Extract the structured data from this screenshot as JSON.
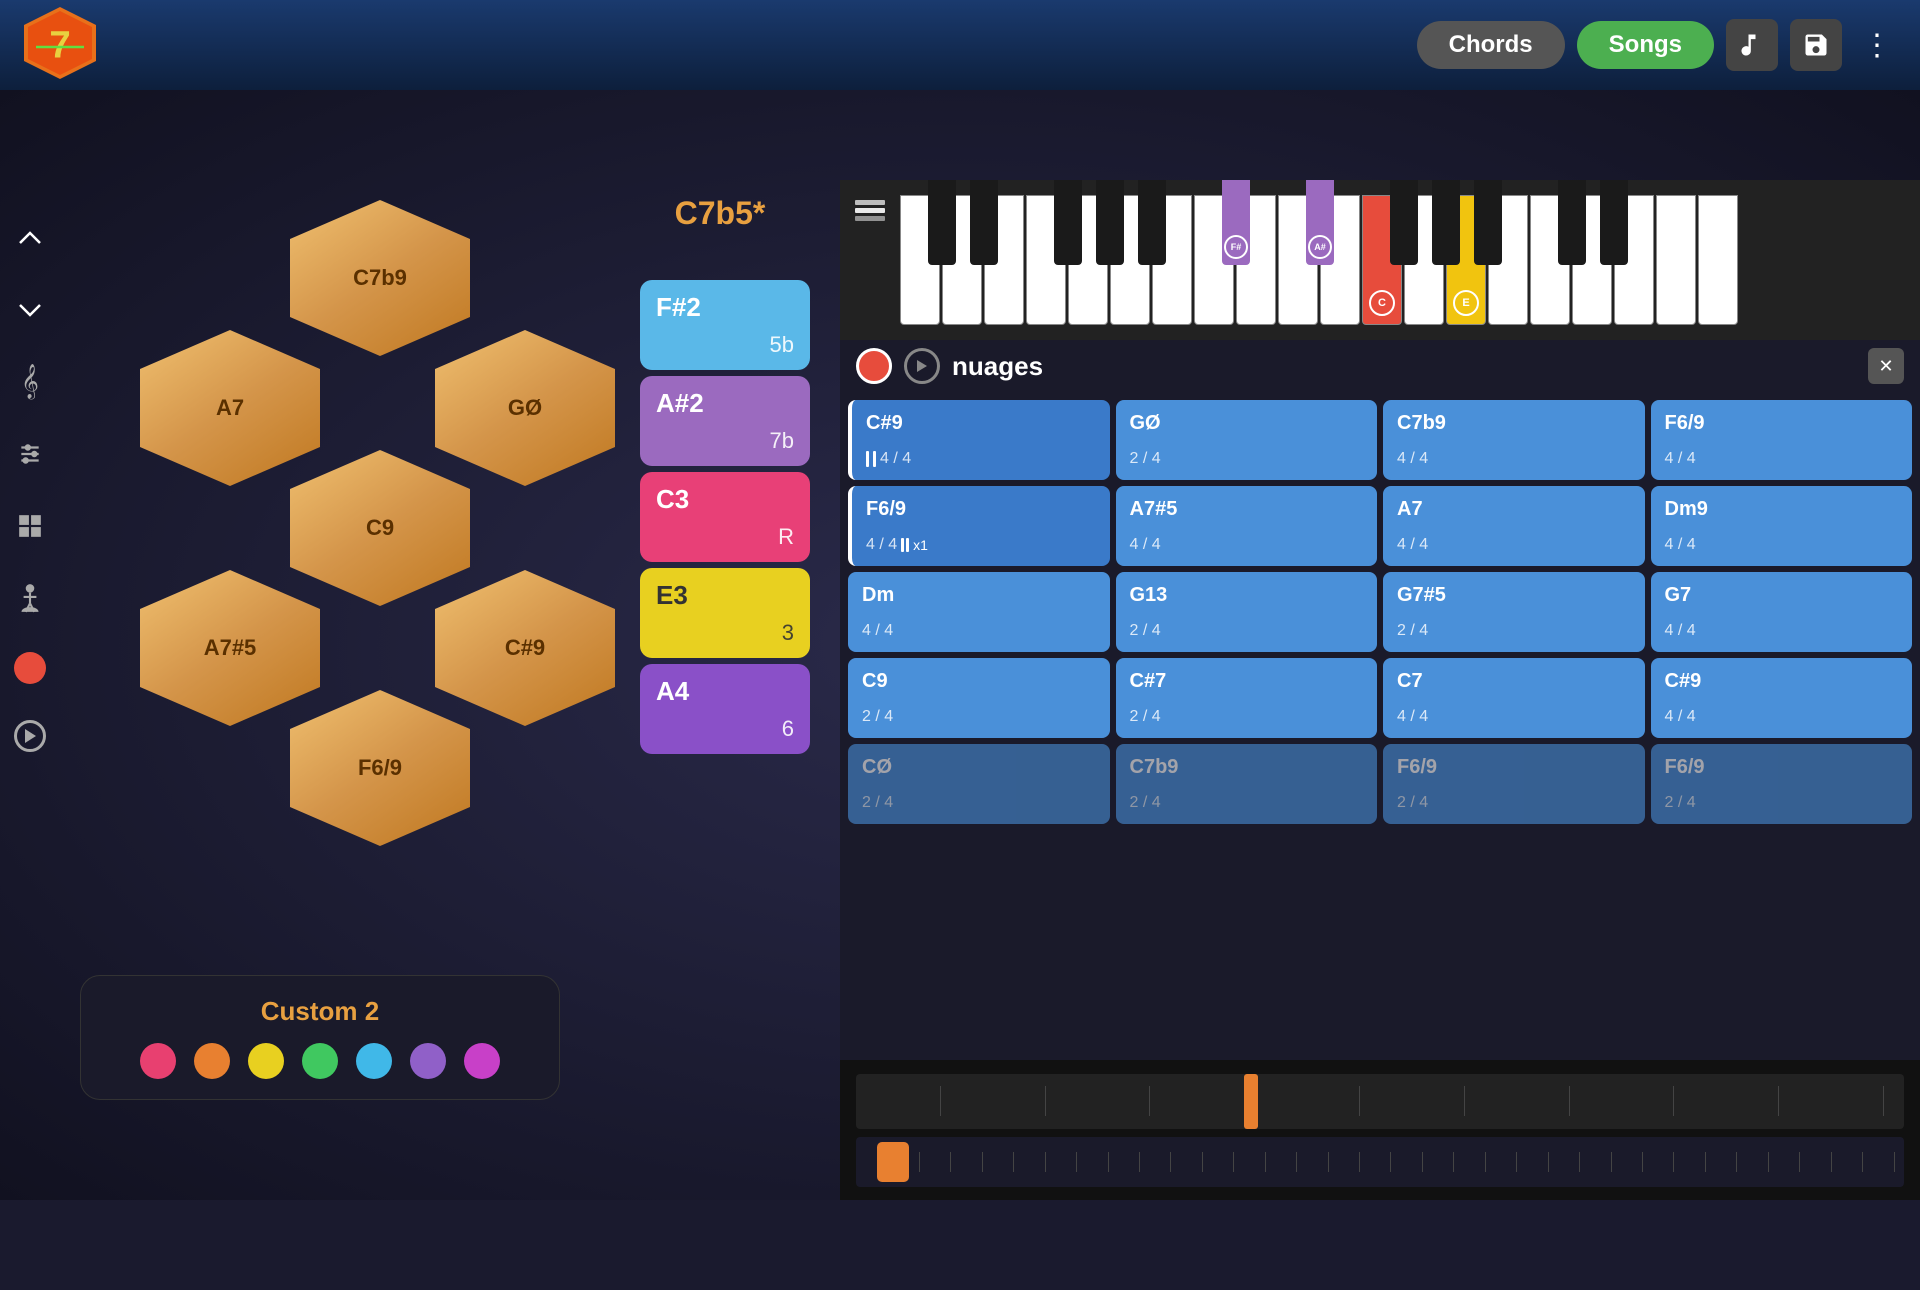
{
  "header": {
    "btn_chords": "Chords",
    "btn_songs": "Songs",
    "btn_music_note": "♪",
    "btn_save": "💾",
    "btn_more": "⋮"
  },
  "sidebar": {
    "icons": [
      {
        "name": "chevron-up",
        "glyph": "⌃"
      },
      {
        "name": "chevron-down",
        "glyph": "⌄"
      },
      {
        "name": "treble-clef",
        "glyph": "𝄞"
      },
      {
        "name": "mixer",
        "glyph": "⚙"
      },
      {
        "name": "grid",
        "glyph": "▦"
      },
      {
        "name": "person",
        "glyph": "🚶"
      },
      {
        "name": "record",
        "glyph": ""
      },
      {
        "name": "play",
        "glyph": "▶"
      }
    ]
  },
  "hex_grid": {
    "chords": [
      {
        "label": "C7b9",
        "row": 0,
        "col": 0
      },
      {
        "label": "A7",
        "row": 1,
        "col": -1
      },
      {
        "label": "GØ",
        "row": 1,
        "col": 1
      },
      {
        "label": "C9",
        "row": 2,
        "col": 0
      },
      {
        "label": "A7#5",
        "row": 3,
        "col": -1
      },
      {
        "label": "C#9",
        "row": 3,
        "col": 1
      },
      {
        "label": "F6/9",
        "row": 4,
        "col": 0
      }
    ]
  },
  "chord_display": {
    "title": "C7b5*",
    "cards": [
      {
        "name": "F#2",
        "num": "5b",
        "color": "blue"
      },
      {
        "name": "A#2",
        "num": "7b",
        "color": "purple"
      },
      {
        "name": "C3",
        "num": "R",
        "color": "pink"
      },
      {
        "name": "E3",
        "num": "3",
        "color": "yellow"
      },
      {
        "name": "A4",
        "num": "6",
        "color": "purple2"
      }
    ]
  },
  "custom_panel": {
    "title": "Custom 2",
    "colors": [
      "#e84070",
      "#e88030",
      "#e8d020",
      "#40c860",
      "#40b8e8",
      "#9060c8",
      "#c840c8"
    ]
  },
  "piano": {
    "active_notes": [
      "F#",
      "A#",
      "C",
      "E"
    ],
    "note_labels": [
      "F#",
      "A#",
      "C",
      "E"
    ]
  },
  "song": {
    "title": "nuages",
    "chord_tiles": [
      {
        "name": "C#9",
        "time": "4 / 4",
        "active": true
      },
      {
        "name": "GØ",
        "time": "2 / 4",
        "active": false
      },
      {
        "name": "C7b9",
        "time": "4 / 4",
        "active": false
      },
      {
        "name": "F6/9",
        "time": "4 / 4",
        "active": false
      },
      {
        "name": "F6/9",
        "time": "4 / 4",
        "active": true
      },
      {
        "name": "A7#5",
        "time": "4 / 4",
        "active": false
      },
      {
        "name": "A7",
        "time": "4 / 4",
        "active": false
      },
      {
        "name": "Dm9",
        "time": "4 / 4",
        "active": false
      },
      {
        "name": "Dm",
        "time": "4 / 4",
        "active": false
      },
      {
        "name": "G13",
        "time": "2 / 4",
        "active": false
      },
      {
        "name": "G7#5",
        "time": "2 / 4",
        "active": false
      },
      {
        "name": "G7",
        "time": "4 / 4",
        "active": false
      },
      {
        "name": "C9",
        "time": "2 / 4",
        "active": false
      },
      {
        "name": "C#7",
        "time": "2 / 4",
        "active": false
      },
      {
        "name": "C7",
        "time": "4 / 4",
        "active": false
      },
      {
        "name": "C#9",
        "time": "4 / 4",
        "active": false
      },
      {
        "name": "CØ",
        "time": "2 / 4",
        "active": false
      },
      {
        "name": "C7b9",
        "time": "2 / 4",
        "active": false
      },
      {
        "name": "F6/9",
        "time": "2 / 4",
        "active": false
      },
      {
        "name": "F6/9",
        "time": "2 / 4",
        "active": false
      }
    ]
  },
  "timeline": {
    "marker_position_pct": 37,
    "scroll_position_pct": 5
  }
}
